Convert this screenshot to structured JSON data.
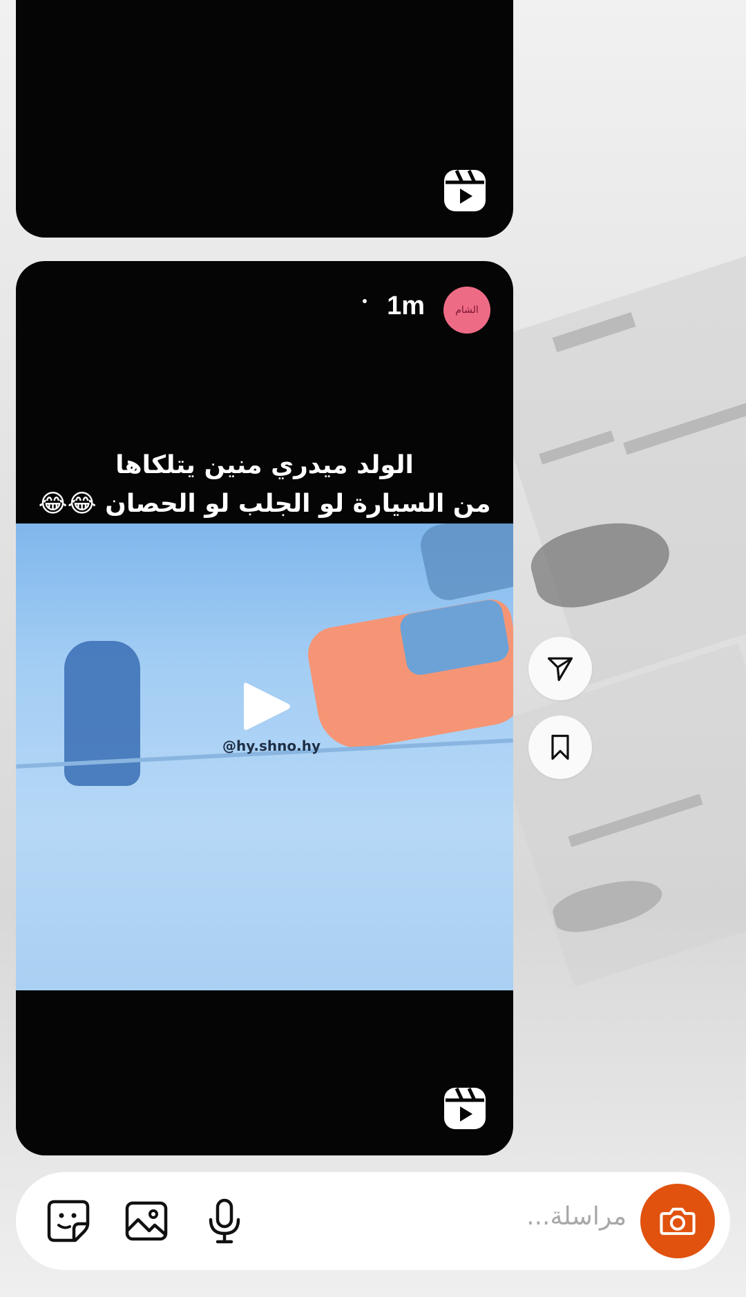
{
  "post": {
    "time": "1m",
    "avatar_text": "الشام",
    "caption_line1": "الولد ميدري منين يتلكاها",
    "caption_line2": "من السيارة لو الجلب لو الحصان 😂😂",
    "watermark": "@hy.shno.hy"
  },
  "composer": {
    "placeholder": "مراسلة..."
  },
  "icons": {
    "reel": "reel-icon",
    "play": "play-icon",
    "share": "paper-plane-icon",
    "save": "bookmark-icon",
    "sticker": "sticker-icon",
    "gallery": "gallery-icon",
    "mic": "microphone-icon",
    "camera": "camera-icon"
  },
  "colors": {
    "camera_button": "#e0520e",
    "avatar": "#ee6b86",
    "card": "#050505"
  }
}
